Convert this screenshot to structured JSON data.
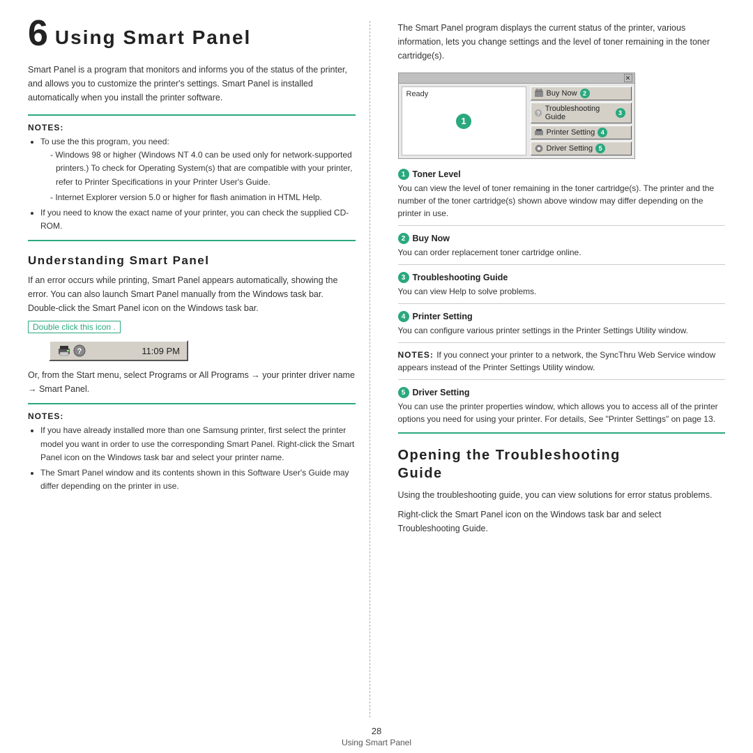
{
  "page": {
    "chapter_num": "6",
    "chapter_title": "Using Smart Panel",
    "intro": "Smart Panel is a program that monitors and informs you of the status of the printer, and allows you to customize the printer's settings. Smart Panel is installed automatically when you install the printer software.",
    "notes_label": "Notes:",
    "notes_items": [
      "To use the this program, you need:",
      "Windows 98 or higher (Windows NT 4.0 can be used only for network-supported printers.) To check for Operating System(s) that are compatible with your printer, refer to Printer Specifications in your Printer User's Guide.",
      "Internet Explorer version 5.0 or higher for flash animation in HTML Help.",
      "If you need to know the exact name of your printer, you can check the supplied CD-ROM."
    ],
    "right_intro": "The Smart Panel program displays the current status of the printer, various information, lets you change settings and the level of toner remaining in the toner cartridge(s).",
    "smart_panel_ui": {
      "ready_label": "Ready",
      "close_btn": "x",
      "buttons": [
        {
          "num": "2",
          "label": "Buy Now"
        },
        {
          "num": "3",
          "label": "Troubleshooting Guide"
        },
        {
          "num": "4",
          "label": "Printer Setting"
        },
        {
          "num": "5",
          "label": "Driver Setting"
        }
      ],
      "toner_num": "1"
    },
    "features": [
      {
        "num": "1",
        "title": "Toner Level",
        "text": "You can view the level of toner remaining in the toner cartridge(s). The printer and the number of the toner cartridge(s) shown above window may differ depending on the printer in use."
      },
      {
        "num": "2",
        "title": "Buy Now",
        "text": "You can order replacement toner cartridge online."
      },
      {
        "num": "3",
        "title": "Troubleshooting Guide",
        "text": "You can view Help to solve problems."
      },
      {
        "num": "4",
        "title": "Printer Setting",
        "text": "You can configure various printer settings in the Printer Settings Utility window."
      },
      {
        "num": "5",
        "title": "Driver Setting",
        "text": "You can use the printer properties window, which allows you to access all of the printer options you need for using your printer. For details, See \"Printer Settings\" on page 13."
      }
    ],
    "notes_right_label": "Notes:",
    "notes_right_text": "If you connect your printer to a network, the SyncThru Web Service window appears instead of the Printer Settings Utility window.",
    "understanding_heading": "Understanding Smart Panel",
    "understanding_text": "If an error occurs while printing, Smart Panel appears automatically, showing the error. You can also launch Smart Panel manually from the Windows task bar. Double-click the Smart Panel icon on the Windows task bar.",
    "double_click_label": "Double click this icon .",
    "taskbar_time": "11:09 PM",
    "nav_text": "Or, from the Start menu, select Programs or All Programs → your printer driver name → Smart Panel.",
    "notes2_label": "Notes:",
    "notes2_items": [
      "If you have already installed more than one Samsung printer, first select the printer model you want in order to use the corresponding Smart Panel. Right-click the Smart Panel icon on the Windows task bar and select your printer name.",
      "The Smart Panel window and its contents shown in this Software User's Guide may differ depending on the printer in use."
    ],
    "opening_heading": "Opening the Troubleshooting\nGuide",
    "opening_text1": "Using the troubleshooting guide, you can view solutions for error status problems.",
    "opening_text2": "Right-click the Smart Panel icon on the Windows task bar and select Troubleshooting Guide.",
    "footer_page": "28",
    "footer_label": "Using Smart Panel"
  }
}
